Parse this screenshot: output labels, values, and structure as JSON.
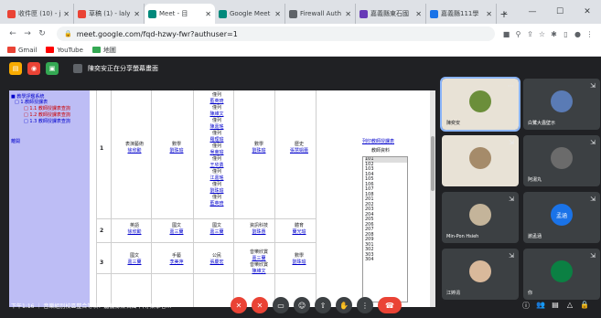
{
  "tabs": [
    {
      "title": "收件匣 (10) - j",
      "fav": "#ea4335"
    },
    {
      "title": "草稿 (1) - laly",
      "fav": "#ea4335"
    },
    {
      "title": "Meet - 目",
      "fav": "#00897b",
      "active": true
    },
    {
      "title": "Google Meet",
      "fav": "#00897b"
    },
    {
      "title": "Firewall Auth",
      "fav": "#5f6368"
    },
    {
      "title": "嘉義縣東石國",
      "fav": "#673ab7"
    },
    {
      "title": "嘉義縣111學",
      "fav": "#1a73e8"
    }
  ],
  "addressbar": {
    "url": "meet.google.com/fqd-hzwy-fwr?authuser=1"
  },
  "bookmarks": [
    {
      "label": "Gmail",
      "color": "#ea4335"
    },
    {
      "label": "YouTube",
      "color": "#ff0000"
    },
    {
      "label": "地圖",
      "color": "#34a853"
    }
  ],
  "presenting_text": "陳奕安正在分享螢幕畫面",
  "leftnav": [
    "■ 教學評鑑系統",
    "□ 1.教師授課表",
    "□ 1.1 教師授課表查詢",
    "□ 1.2 教師授課表查詢",
    "□ 1.3 教師授課表查詢",
    "離開"
  ],
  "grid": {
    "row_numbers": [
      "1",
      "2",
      "3"
    ],
    "r1": {
      "c1": [
        "表演藝術",
        "徐欣勳"
      ],
      "c2": [
        "數學",
        "劉珠瑜"
      ],
      "c3": [
        "僅列",
        "藍英琦",
        "僅列",
        "陳維文",
        "僅列",
        "陳嘉瑤",
        "僅列",
        "羅理瑜",
        "僅列",
        "吳東瑜",
        "僅列",
        "王欣勇",
        "僅列",
        "江嘉瑤",
        "僅列",
        "劉珠瑜",
        "僅列",
        "藍英琦"
      ],
      "c4": [
        "數學",
        "劉珠瑜"
      ],
      "c5": [
        "歷史",
        "張慧娟蕾"
      ]
    },
    "r2": {
      "c1": [
        "英語",
        "徐欣勳"
      ],
      "c2": [
        "國文",
        "嘉三蘭"
      ],
      "c3": [
        "國文",
        "嘉三蘭"
      ],
      "c4": [
        "資訊科技",
        "劉珠惠"
      ],
      "c5": [
        "體育",
        "蘭光瑜"
      ]
    },
    "r3": {
      "c1": [
        "國文",
        "嘉三蘭"
      ],
      "c2": [
        "手藝",
        "李美萍"
      ],
      "c3": [
        "公民",
        "張慶宏"
      ],
      "c4": [
        "音樂欣賞",
        "嘉三蘭",
        "音樂欣賞",
        "陳維文"
      ],
      "c5": [
        "數學",
        "劉珠瑜"
      ]
    }
  },
  "rightpane": {
    "link": "列印教師授課表",
    "label": "教師資料",
    "options": [
      "101",
      "102",
      "103",
      "104",
      "105",
      "106",
      "107",
      "108",
      "201",
      "202",
      "203",
      "204",
      "205",
      "206",
      "207",
      "208",
      "209",
      "301",
      "302",
      "303",
      "304"
    ]
  },
  "participants": [
    {
      "name": "陳奕安",
      "bg": "#ffffff",
      "av": "#6b8e3a",
      "speaking": true
    },
    {
      "name": "白鷺大蟲壁示",
      "bg": "#3c4043",
      "av": "#5a7bb5"
    },
    {
      "name": "",
      "bg": "#ffffff",
      "av": "#a58b6a"
    },
    {
      "name": "阿湯丸",
      "bg": "#4a4a4a",
      "av": "#6b6b6b"
    },
    {
      "name": "Min-Pon Hsieh",
      "bg": "#3c4043",
      "av": "#c4b49a"
    },
    {
      "name": "謝孟涵",
      "bg": "#3c4043",
      "av": "#1a73e8",
      "letter": "孟涵"
    },
    {
      "name": "江婷涓",
      "bg": "#3c4043",
      "av": "#d9b99b"
    },
    {
      "name": "你",
      "bg": "#3c4043",
      "av": "#0b8043"
    }
  ],
  "bottom": {
    "time": "下午1:16",
    "meeting": "音樂組別校區整合等次：嘉義縣東石國中(專案學者..."
  },
  "colors": {
    "end_call": "#ea4335",
    "mic_off": "#ea4335"
  }
}
